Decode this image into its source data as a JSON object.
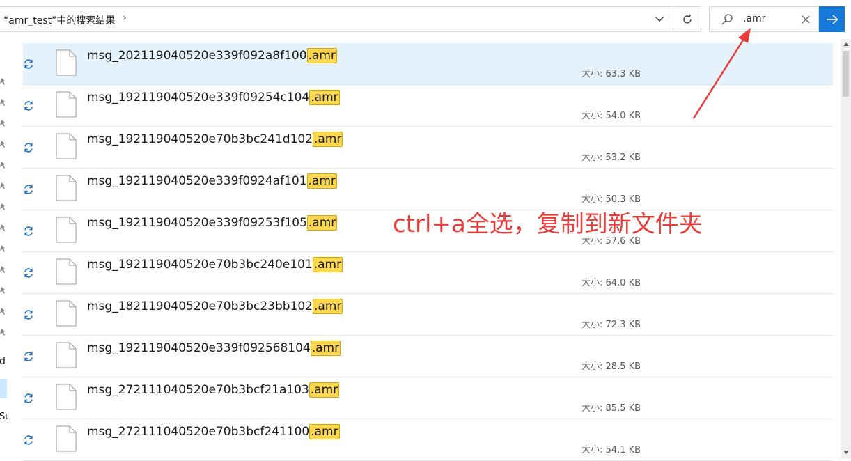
{
  "address_bar": {
    "breadcrumb": "“amr_test”中的搜索结果",
    "chevron": "›",
    "dropdown_icon": "chevron-down-icon",
    "refresh_icon": "refresh-icon"
  },
  "search": {
    "value": ".amr",
    "icon": "search-icon",
    "clear_icon": "close-icon",
    "go_icon": "arrow-right-icon"
  },
  "nav_pane": {
    "partial_text_1": "d",
    "partial_text_2": "Su"
  },
  "files": [
    {
      "prefix": "msg_202119040520e339f092a8f100",
      "ext": ".amr",
      "size_label": "大小:",
      "size": "63.3 KB"
    },
    {
      "prefix": "msg_192119040520e339f09254c104",
      "ext": ".amr",
      "size_label": "大小:",
      "size": "54.0 KB"
    },
    {
      "prefix": "msg_192119040520e70b3bc241d102",
      "ext": ".amr",
      "size_label": "大小:",
      "size": "53.2 KB"
    },
    {
      "prefix": "msg_192119040520e339f0924af101",
      "ext": ".amr",
      "size_label": "大小:",
      "size": "50.3 KB"
    },
    {
      "prefix": "msg_192119040520e339f09253f105",
      "ext": ".amr",
      "size_label": "大小:",
      "size": "57.6 KB"
    },
    {
      "prefix": "msg_192119040520e70b3bc240e101",
      "ext": ".amr",
      "size_label": "大小:",
      "size": "64.0 KB"
    },
    {
      "prefix": "msg_182119040520e70b3bc23bb102",
      "ext": ".amr",
      "size_label": "大小:",
      "size": "72.3 KB"
    },
    {
      "prefix": "msg_192119040520e339f092568104",
      "ext": ".amr",
      "size_label": "大小:",
      "size": "28.5 KB"
    },
    {
      "prefix": "msg_272111040520e70b3bcf21a103",
      "ext": ".amr",
      "size_label": "大小:",
      "size": "85.5 KB"
    },
    {
      "prefix": "msg_272111040520e70b3bcf241100",
      "ext": ".amr",
      "size_label": "大小:",
      "size": "54.1 KB"
    }
  ],
  "annotation": {
    "text": "ctrl+a全选，复制到新文件夹",
    "color": "#ea3b3b"
  },
  "colors": {
    "highlight": "#fcd74f",
    "selected_row": "#e5f1fb",
    "go_button": "#1479d8",
    "sync_icon": "#1e6fc8"
  }
}
